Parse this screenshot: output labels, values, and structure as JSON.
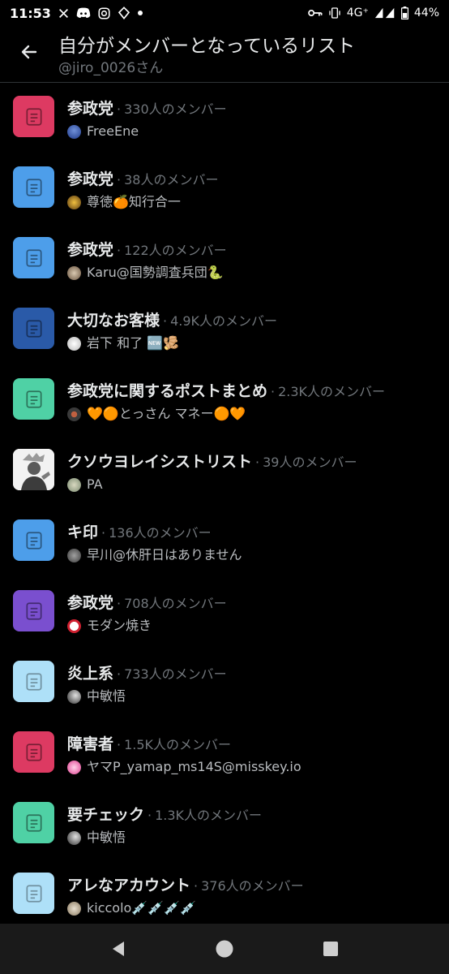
{
  "status_bar": {
    "time": "11:53",
    "network": "4G⁺",
    "battery": "44%"
  },
  "header": {
    "title": "自分がメンバーとなっているリスト",
    "subtitle": "@jiro_0026さん"
  },
  "colors": {
    "red": "#dd3a62",
    "blue": "#4d9eea",
    "navy": "#2a5aa8",
    "teal": "#4fd1a5",
    "purple": "#7a4fcf",
    "light_blue": "#aee0f8"
  },
  "lists": [
    {
      "name": "参政党",
      "members": "330人のメンバー",
      "owner": "FreeEne",
      "color": "#dd3a62"
    },
    {
      "name": "参政党",
      "members": "38人のメンバー",
      "owner": "尊徳🍊知行合一",
      "color": "#4d9eea"
    },
    {
      "name": "参政党",
      "members": "122人のメンバー",
      "owner": "Karu@国勢調査兵団🐍",
      "color": "#4d9eea"
    },
    {
      "name": "大切なお客様",
      "members": "4.9K人のメンバー",
      "owner": "岩下 和了 🆕🫚",
      "color": "#2a5aa8"
    },
    {
      "name": "参政党に関するポストまとめ",
      "members": "2.3K人のメンバー",
      "owner": "🧡🟠とっさん マネー🟠🧡",
      "color": "#4fd1a5"
    },
    {
      "name": "クソウヨレイシストリスト",
      "members": "39人のメンバー",
      "owner": "PA",
      "color": "#f4f4f4"
    },
    {
      "name": "キ印",
      "members": "136人のメンバー",
      "owner": "早川@休肝日はありません",
      "color": "#4d9eea"
    },
    {
      "name": "参政党",
      "members": "708人のメンバー",
      "owner": "モダン焼き",
      "color": "#7a4fcf"
    },
    {
      "name": "炎上系",
      "members": "733人のメンバー",
      "owner": "中敏悟",
      "color": "#aee0f8"
    },
    {
      "name": "障害者",
      "members": "1.5K人のメンバー",
      "owner": "ヤマP_yamap_ms14S@misskey.io",
      "color": "#dd3a62"
    },
    {
      "name": "要チェック",
      "members": "1.3K人のメンバー",
      "owner": "中敏悟",
      "color": "#4fd1a5"
    },
    {
      "name": "アレなアカウント",
      "members": "376人のメンバー",
      "owner": "kiccolo💉💉💉💉",
      "color": "#aee0f8"
    }
  ]
}
